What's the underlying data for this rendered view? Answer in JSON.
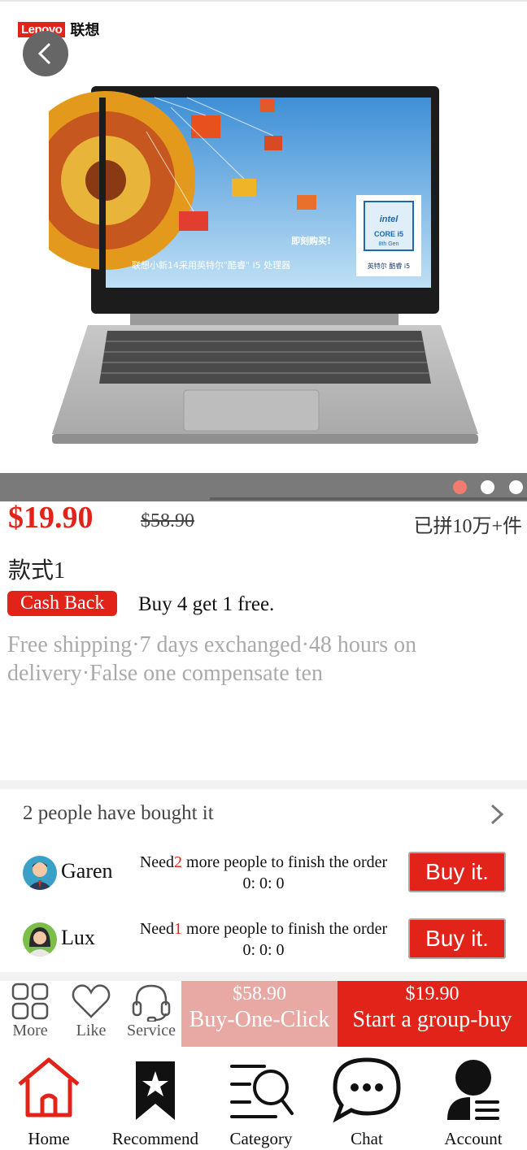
{
  "gallery": {
    "brand_box": "Lenovo",
    "brand_cn": "联想",
    "slides": 3,
    "active_slide": 1,
    "screen_text_cn": "联想小新14采用英特尔\"酷睿\" i5 处理器",
    "screen_cta_cn": "即刻购买!",
    "badge_brand": "intel",
    "badge_core": "CORE i5",
    "badge_gen": "8th Gen",
    "badge_caption_cn": "英特尔 酷睿 i5"
  },
  "product": {
    "price": "$19.90",
    "original_price": "$58.90",
    "sold": "已拼10万+件",
    "style": "款式1",
    "cashback_label": "Cash Back",
    "promo": "Buy 4 get 1 free.",
    "services": "Free shipping·7 days exchanged·48 hours on delivery·False one compensate ten"
  },
  "group_buy": {
    "title": "2 people have bought it",
    "rows": [
      {
        "name": "Garen",
        "need_prefix": "Need",
        "need_num": "2",
        "need_suffix": " more people to finish the order",
        "timer": "0: 0: 0",
        "button": "Buy it."
      },
      {
        "name": "Lux",
        "need_prefix": "Need",
        "need_num": "1",
        "need_suffix": " more people to finish the order",
        "timer": "0: 0: 0",
        "button": "Buy it."
      }
    ]
  },
  "action_bar": {
    "more": "More",
    "like": "Like",
    "service": "Service",
    "one_click_price": "$58.90",
    "one_click_label": "Buy-One-Click",
    "group_price": "$19.90",
    "group_label": "Start a group-buy"
  },
  "tabs": [
    "Home",
    "Recommend",
    "Category",
    "Chat",
    "Account"
  ],
  "colors": {
    "accent": "#e2231a",
    "muted": "#aaaaaa",
    "one_click_bg": "#e8a8a4"
  }
}
